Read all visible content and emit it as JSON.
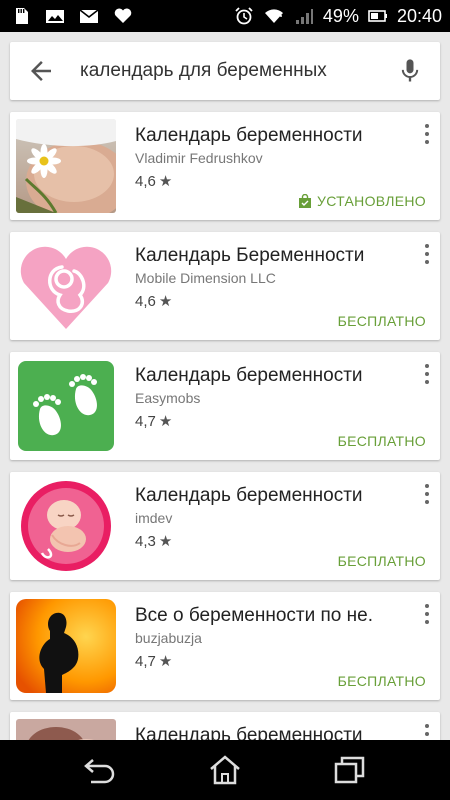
{
  "status_bar": {
    "battery_percent": "49%",
    "time": "20:40",
    "left_icons": [
      "sd-card-icon",
      "image-icon",
      "mail-icon",
      "heart-icon"
    ],
    "right_icons": [
      "alarm-icon",
      "wifi-icon",
      "signal-icon",
      "battery-icon"
    ]
  },
  "search": {
    "query": "календарь для беременных"
  },
  "results": [
    {
      "title": "Календарь беременности",
      "developer": "Vladimir Fedrushkov",
      "rating": "4,6",
      "status": "УСТАНОВЛЕНО",
      "icon": "belly-daisy-photo"
    },
    {
      "title": "Календарь Беременности",
      "developer": "Mobile Dimension LLC",
      "rating": "4,6",
      "status": "БЕСПЛАТНО",
      "icon": "pink-heart-fetus"
    },
    {
      "title": "Календарь беременности",
      "developer": "Easymobs",
      "rating": "4,7",
      "status": "БЕСПЛАТНО",
      "icon": "green-footprints"
    },
    {
      "title": "Календарь беременности",
      "developer": "imdev",
      "rating": "4,3",
      "status": "БЕСПЛАТНО",
      "icon": "pink-circle-baby"
    },
    {
      "title": "Все о беременности по не.",
      "developer": "buzjabuzja",
      "rating": "4,7",
      "status": "БЕСПЛАТНО",
      "icon": "orange-silhouette"
    },
    {
      "title": "Календарь беременности",
      "icon": "partial-photo"
    }
  ],
  "colors": {
    "accent_green": "#689f38",
    "status_bar": "#000000",
    "card_bg": "#ffffff",
    "page_bg": "#e9e9e9"
  }
}
